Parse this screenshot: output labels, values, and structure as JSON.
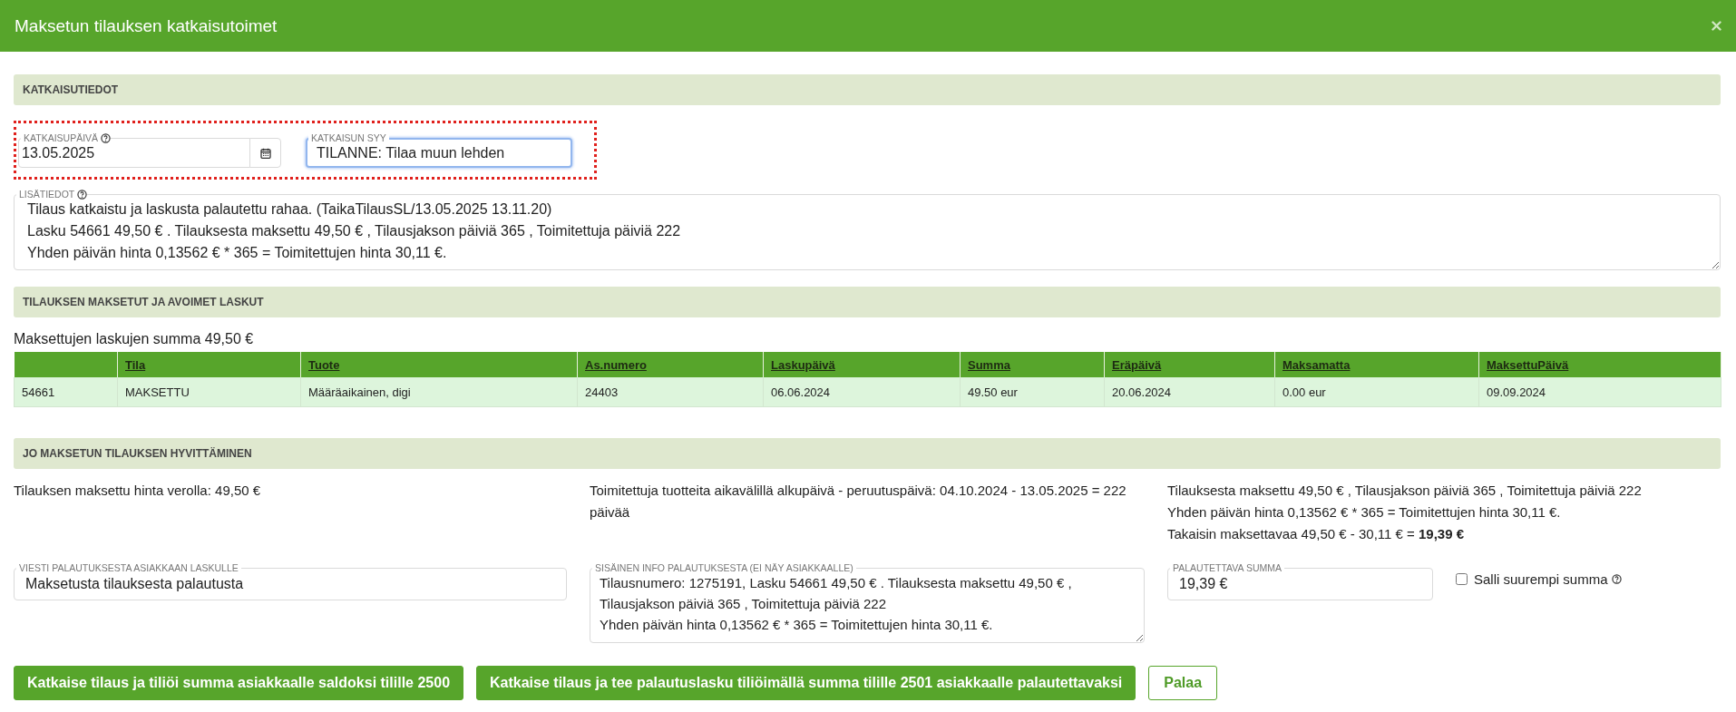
{
  "dialog": {
    "title": "Maksetun tilauksen katkaisutoimet"
  },
  "cancellation_info": {
    "heading": "KATKAISUTIEDOT",
    "highlighted": true,
    "date_field": {
      "label": "KATKAISUPÄIVÄ",
      "value": "13.05.2025"
    },
    "reason_field": {
      "label": "KATKAISUN SYY",
      "value": "TILANNE: Tilaa muun lehden",
      "focused": true
    },
    "additional_info": {
      "label": "LISÄTIEDOT",
      "lines": [
        "Tilaus katkaistu ja laskusta palautettu rahaa. (TaikaTilausSL/13.05.2025 13.11.20)",
        "Lasku 54661 49,50 € . Tilauksesta maksettu 49,50 € , Tilausjakson päiviä 365 , Toimitettuja päiviä 222",
        "Yhden päivän hinta 0,13562 € * 365 = Toimitettujen hinta 30,11 €."
      ]
    }
  },
  "invoices": {
    "heading": "TILAUKSEN MAKSETUT JA AVOIMET LASKUT",
    "summary": "Maksettujen laskujen summa 49,50 €",
    "table": {
      "columns": [
        "",
        "Tila",
        "Tuote",
        "As.numero",
        "Laskupäivä",
        "Summa",
        "Eräpäivä",
        "Maksamatta",
        "MaksettuPäivä"
      ],
      "rows": [
        [
          "54661",
          "MAKSETTU",
          "Määräaikainen, digi",
          "24403",
          "06.06.2024",
          "49.50 eur",
          "20.06.2024",
          "0.00 eur",
          "09.09.2024"
        ]
      ]
    }
  },
  "refund": {
    "heading": "JO MAKSETUN TILAUKSEN HYVITTÄMINEN",
    "paid_price": "Tilauksen maksettu hinta verolla: 49,50 €",
    "delivered_period": "Toimitettuja tuotteita aikavälillä alkupäivä - peruutuspäivä: 04.10.2024 - 13.05.2025 = 222 päivää",
    "calculation": [
      "Tilauksesta maksettu 49,50 € , Tilausjakson päiviä 365 , Toimitettuja päiviä 222",
      "Yhden päivän hinta 0,13562 € * 365 = Toimitettujen hinta 30,11 €.",
      "Takaisin maksettavaa 49,50 € - 30,11 € = **19,39 €**"
    ],
    "message_field": {
      "label": "VIESTI PALAUTUKSESTA ASIAKKAAN LASKULLE",
      "value": "Maksetusta tilauksesta palautusta"
    },
    "internal_info": {
      "label": "SISÄINEN INFO PALAUTUKSESTA (EI NÄY ASIAKKAALLE)",
      "lines": [
        "Tilausnumero: 1275191, Lasku 54661 49,50 € . Tilauksesta maksettu 49,50 € , Tilausjakson päiviä 365 , Toimitettuja päiviä 222",
        "Yhden päivän hinta 0,13562 € * 365 = Toimitettujen hinta 30,11 €."
      ]
    },
    "amount_field": {
      "label": "PALAUTETTAVA SUMMA",
      "value": "19,39 €"
    },
    "allow_larger": {
      "label": "Salli suurempi summa",
      "checked": false
    }
  },
  "buttons": [
    {
      "label": "Katkaise tilaus ja tiliöi summa asiakkaalle saldoksi tilille 2500",
      "kind": "primary"
    },
    {
      "label": "Katkaise tilaus ja tee palautuslasku tiliöimällä summa tilille 2501 asiakkaalle palautettavaksi",
      "kind": "primary"
    },
    {
      "label": "Palaa",
      "kind": "secondary"
    }
  ]
}
